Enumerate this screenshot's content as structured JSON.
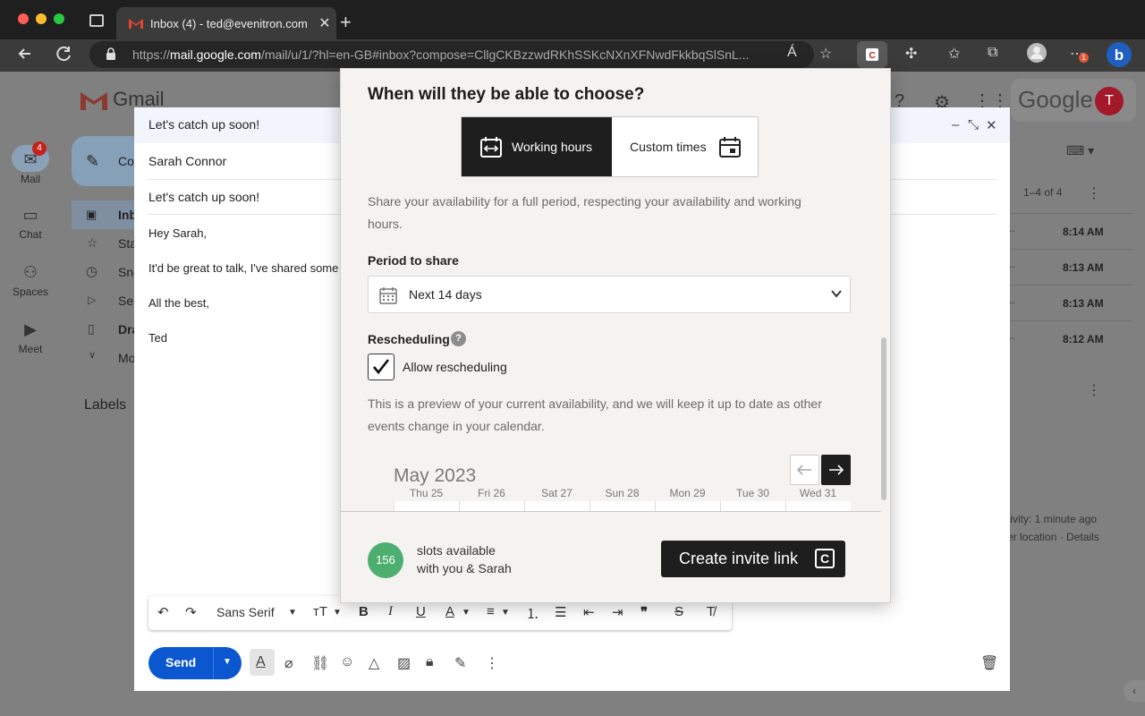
{
  "browser": {
    "tab_title": "Inbox (4) - ted@evenitron.com",
    "tab_close": "✕",
    "new_tab": "+",
    "url_prefix": "https://",
    "url_host": "mail.google.com",
    "url_rest": "/mail/u/1/?hl=en-GB#inbox?compose=CllgCKBzzwdRKhSSKcNXnXFNwdFkkbqSlSnL...",
    "read_aloud": "Á",
    "profile_badge": "1"
  },
  "gmail": {
    "logo": "Gmail",
    "google_word": "Google",
    "avatar_letter": "T",
    "rail": [
      {
        "label": "Mail",
        "icon": "mail-icon",
        "glyph": "✉",
        "badge": "4"
      },
      {
        "label": "Chat",
        "icon": "chat-icon",
        "glyph": "▭"
      },
      {
        "label": "Spaces",
        "icon": "spaces-icon",
        "glyph": "⚇"
      },
      {
        "label": "Meet",
        "icon": "meet-icon",
        "glyph": "▶"
      }
    ],
    "compose_label": "Co",
    "nav": [
      {
        "label": "Inb"
      },
      {
        "label": "Sta"
      },
      {
        "label": "Sno"
      },
      {
        "label": "Se"
      },
      {
        "label": "Dra"
      },
      {
        "label": "Mo"
      }
    ],
    "labels_heading": "Labels",
    "count": "1–4 of 4",
    "times": [
      "8:14 AM",
      "8:13 AM",
      "8:13 AM",
      "8:12 AM"
    ],
    "row_dots": [
      "..",
      "..",
      "..",
      ".."
    ],
    "activity_1": "tivity: 1 minute ago",
    "activity_2": "er location · Details"
  },
  "compose": {
    "header_title": "Let's catch up soon!",
    "to": "Sarah Connor",
    "subject": "Let's catch up soon!",
    "body": [
      "Hey Sarah,",
      "It'd be great to talk, I've shared some",
      "All the best,",
      "Ted"
    ],
    "font_name": "Sans Serif",
    "send_label": "Send"
  },
  "popup": {
    "title": "When will they be able to choose?",
    "mode_working": "Working hours",
    "mode_custom": "Custom times",
    "description": "Share your availability for a full period, respecting your availability and working hours.",
    "period_label": "Period to share",
    "period_value": "Next 14 days",
    "rescheduling_label": "Rescheduling",
    "help": "?",
    "allow_label": "Allow rescheduling",
    "allow_checked": true,
    "preview_text": "This is a preview of your current availability, and we will keep it up to date as other events change in your calendar.",
    "month": "May 2023",
    "prev_arrow": "←",
    "next_arrow": "→",
    "days": [
      "Thu 25",
      "Fri 26",
      "Sat 27",
      "Sun 28",
      "Mon 29",
      "Tue 30",
      "Wed 31"
    ],
    "slots_count": "156",
    "slots_line1": "slots available",
    "slots_line2": "with you & Sarah",
    "create_label": "Create invite link",
    "create_icon_letter": "C"
  }
}
